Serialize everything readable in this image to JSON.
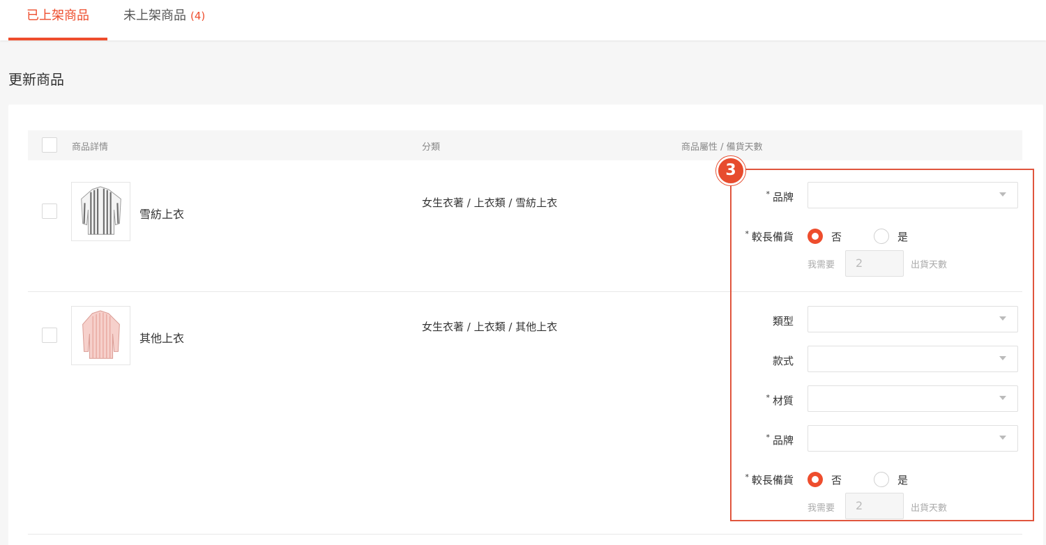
{
  "tabs": {
    "active_label": "已上架商品",
    "inactive_label": "未上架商品",
    "inactive_count": "(4)"
  },
  "page_title": "更新商品",
  "table": {
    "headers": [
      "商品詳情",
      "分類",
      "商品屬性 / 備貨天數"
    ]
  },
  "step_badge": "3",
  "products": [
    {
      "name": "雪紡上衣",
      "category": "女生衣著 / 上衣類 / 雪紡上衣",
      "thumbnail": "striped-shirt-grey",
      "fields": [
        {
          "label": "品牌",
          "required": "*",
          "value": ""
        }
      ],
      "long_stock": {
        "label": "較長備貨",
        "required": "*",
        "options": [
          "否",
          "是"
        ],
        "selected": "否",
        "need_text": "我需要",
        "days": "2",
        "suffix": "出貨天數"
      }
    },
    {
      "name": "其他上衣",
      "category": "女生衣著 / 上衣類 / 其他上衣",
      "thumbnail": "striped-shirt-pink",
      "fields": [
        {
          "label": "類型",
          "required": "",
          "value": ""
        },
        {
          "label": "款式",
          "required": "",
          "value": ""
        },
        {
          "label": "材質",
          "required": "*",
          "value": ""
        },
        {
          "label": "品牌",
          "required": "*",
          "value": ""
        }
      ],
      "long_stock": {
        "label": "較長備貨",
        "required": "*",
        "options": [
          "否",
          "是"
        ],
        "selected": "否",
        "need_text": "我需要",
        "days": "2",
        "suffix": "出貨天數"
      }
    }
  ],
  "colors": {
    "accent": "#ee4d2d",
    "highlight_border": "#e0553d"
  }
}
